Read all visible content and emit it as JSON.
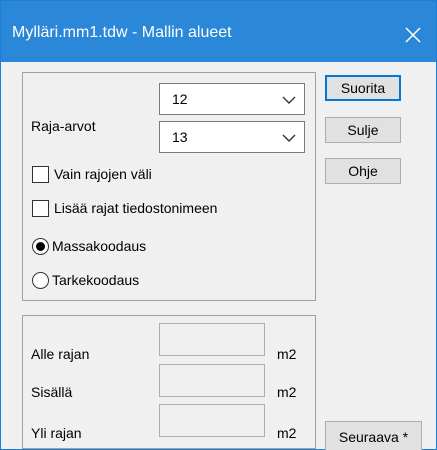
{
  "window": {
    "title": "Mylläri.mm1.tdw - Mallin alueet"
  },
  "limits": {
    "label": "Raja-arvot",
    "lower_value": "12",
    "upper_value": "13"
  },
  "options": {
    "only_between_label": "Vain rajojen väli",
    "add_to_filename_label": "Lisää rajat tiedostonimeen",
    "only_between_checked": false,
    "add_to_filename_checked": false
  },
  "coding": {
    "mass_label": "Massakoodaus",
    "precision_label": "Tarkekoodaus",
    "selected": "Massakoodaus"
  },
  "areas": {
    "below_label": "Alle rajan",
    "inside_label": "Sisällä",
    "above_label": "Yli rajan",
    "below_value": "",
    "inside_value": "",
    "above_value": "",
    "unit": "m2"
  },
  "buttons": {
    "run": "Suorita",
    "close": "Sulje",
    "help": "Ohje",
    "next": "Seuraava *"
  },
  "colors": {
    "titlebar": "#2b88d8",
    "accent": "#0078d7"
  },
  "icons": {
    "close": "close-icon",
    "dropdown": "chevron-down-icon"
  }
}
